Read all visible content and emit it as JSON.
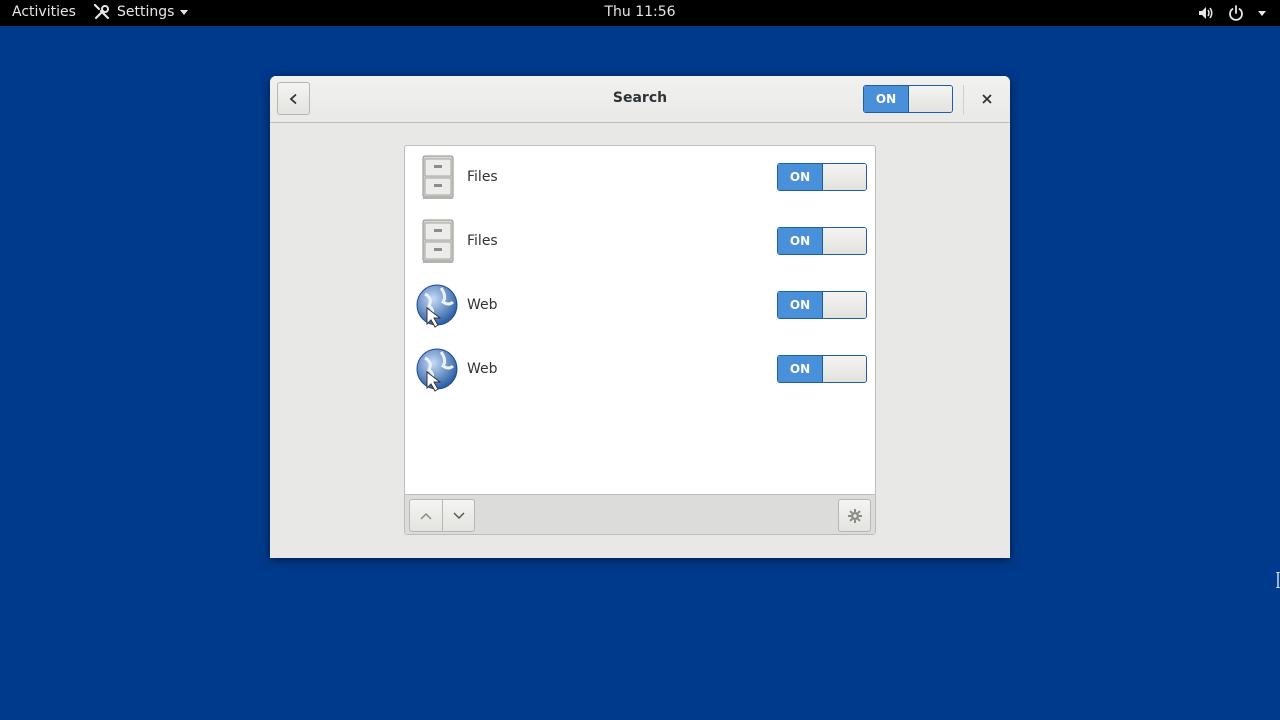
{
  "topbar": {
    "activities": "Activities",
    "app_menu_label": "Settings",
    "clock": "Thu 11:56",
    "icons": [
      "tools-icon",
      "volume-icon",
      "power-icon",
      "chevron-down-icon"
    ]
  },
  "dialog": {
    "title": "Search",
    "master_switch": "ON",
    "back_icon": "chevron-left-icon",
    "close_icon": "close-icon"
  },
  "list": {
    "items": [
      {
        "name": "Files",
        "icon": "file-cabinet-icon",
        "switch": "ON"
      },
      {
        "name": "Files",
        "icon": "file-cabinet-icon",
        "switch": "ON"
      },
      {
        "name": "Web",
        "icon": "globe-icon",
        "switch": "ON"
      },
      {
        "name": "Web",
        "icon": "globe-icon",
        "switch": "ON"
      }
    ],
    "toolbar_icons": [
      "chevron-up-icon",
      "chevron-down-icon",
      "gear-icon"
    ]
  },
  "colors": {
    "desktop": "#003a8c",
    "accent": "#4a90d9",
    "topbar": "#000000"
  }
}
